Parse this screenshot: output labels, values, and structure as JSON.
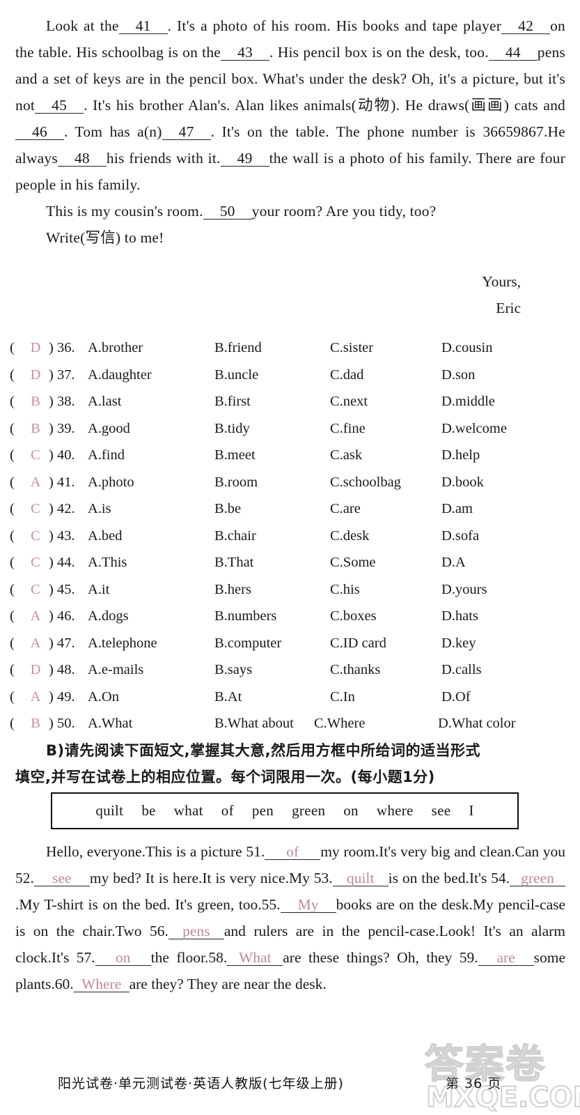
{
  "colors": {
    "answer_pink": "#c9909a",
    "ink": "#1a1a1a"
  },
  "cloze_passage": {
    "line1_a": "Look at the",
    "blank41": "41",
    "line1_b": ". It's a photo of his room. His books and tape",
    "line2_a": "player",
    "blank42": "42",
    "line2_b": "on the table. His schoolbag is on the",
    "blank43": "43",
    "line2_c": ". His pencil",
    "line3_a": "box is on the desk, too.",
    "blank44": "44",
    "line3_b": "pens and a set of keys are in the pencil",
    "line4_a": "box. What's under the desk? Oh, it's a picture, but it's not",
    "blank45": "45",
    "line4_b": ". It's",
    "line5": "his brother Alan's. Alan likes animals(动物). He draws(画画) cats and",
    "blank46": "46",
    "line6_a": ". Tom has a(n)",
    "blank47": "47",
    "line6_b": ". It's on the table. The phone number is",
    "line7_a": "36659867.He always",
    "blank48": "48",
    "line7_b": "his friends with it.",
    "blank49": "49",
    "line7_c": "the wall is a",
    "line8": "photo of his family. There are four people in his family.",
    "para2_a": "This is my cousin's room.",
    "blank50": "50",
    "para2_b": "your room? Are you tidy, too?",
    "para3": "Write(写信) to me!",
    "sign_yours": "Yours,",
    "sign_name": "Eric"
  },
  "mc_questions": [
    {
      "answer": "D",
      "num": "36.",
      "a": "A.brother",
      "b": "B.friend",
      "c": "C.sister",
      "d": "D.cousin"
    },
    {
      "answer": "D",
      "num": "37.",
      "a": "A.daughter",
      "b": "B.uncle",
      "c": "C.dad",
      "d": "D.son"
    },
    {
      "answer": "B",
      "num": "38.",
      "a": "A.last",
      "b": "B.first",
      "c": "C.next",
      "d": "D.middle"
    },
    {
      "answer": "B",
      "num": "39.",
      "a": "A.good",
      "b": "B.tidy",
      "c": "C.fine",
      "d": "D.welcome"
    },
    {
      "answer": "C",
      "num": "40.",
      "a": "A.find",
      "b": "B.meet",
      "c": "C.ask",
      "d": "D.help"
    },
    {
      "answer": "A",
      "num": "41.",
      "a": "A.photo",
      "b": "B.room",
      "c": "C.schoolbag",
      "d": "D.book"
    },
    {
      "answer": "C",
      "num": "42.",
      "a": "A.is",
      "b": "B.be",
      "c": "C.are",
      "d": "D.am"
    },
    {
      "answer": "C",
      "num": "43.",
      "a": "A.bed",
      "b": "B.chair",
      "c": "C.desk",
      "d": "D.sofa"
    },
    {
      "answer": "C",
      "num": "44.",
      "a": "A.This",
      "b": "B.That",
      "c": "C.Some",
      "d": "D.A"
    },
    {
      "answer": "C",
      "num": "45.",
      "a": "A.it",
      "b": "B.hers",
      "c": "C.his",
      "d": "D.yours"
    },
    {
      "answer": "A",
      "num": "46.",
      "a": "A.dogs",
      "b": "B.numbers",
      "c": "C.boxes",
      "d": "D.hats"
    },
    {
      "answer": "A",
      "num": "47.",
      "a": "A.telephone",
      "b": "B.computer",
      "c": "C.ID card",
      "d": "D.key"
    },
    {
      "answer": "D",
      "num": "48.",
      "a": "A.e-mails",
      "b": "B.says",
      "c": "C.thanks",
      "d": "D.calls"
    },
    {
      "answer": "A",
      "num": "49.",
      "a": "A.On",
      "b": "B.At",
      "c": "C.In",
      "d": "D.Of"
    },
    {
      "answer": "B",
      "num": "50.",
      "a": "A.What",
      "b": "B.What about",
      "c": "C.Where",
      "d": "D.What color",
      "wide": true
    }
  ],
  "section_b": {
    "line1": "B)请先阅读下面短文,掌握其大意,然后用方框中所给词的适当形式",
    "line2": "填空,并写在试卷上的相应位置。每个词限用一次。(每小题1分)"
  },
  "word_bank": [
    "quilt",
    "be",
    "what",
    "of",
    "pen",
    "green",
    "on",
    "where",
    "see",
    "I"
  ],
  "fill_passage": {
    "t1": "Hello, everyone.This is a picture 51.",
    "b51": "of",
    "t2": "my room.It's very big",
    "t3": "and clean.Can you 52.",
    "b52": "see",
    "t4": "my bed? It is here.It is very nice.My",
    "t5": "53.",
    "b53": "quilt",
    "t6": "is on the bed.It's 54.",
    "b54": "green",
    "t7": ".My T-shirt is on the bed.",
    "t8": "It's green, too.55.",
    "b55": "My",
    "t9": "books are on the desk.My pencil-case is on",
    "t10": "the chair.Two 56.",
    "b56": "pens",
    "t11": "and rulers are in the pencil-case.Look! It's",
    "t12": "an alarm clock.It's 57.",
    "b57": "on",
    "t13": "the floor.58.",
    "b58": "What",
    "t14": "are these things?",
    "t15": "Oh, they 59.",
    "b59": "are",
    "t16": "some plants.60.",
    "b60": "Where",
    "t17": "are they? They are near",
    "t18": "the desk."
  },
  "footer": {
    "title": "阳光试卷·单元测试卷·英语人教版(七年级上册)",
    "page": "第 36 页"
  },
  "watermark": {
    "cn": "答案卷",
    "en": "MXQE.COM"
  }
}
